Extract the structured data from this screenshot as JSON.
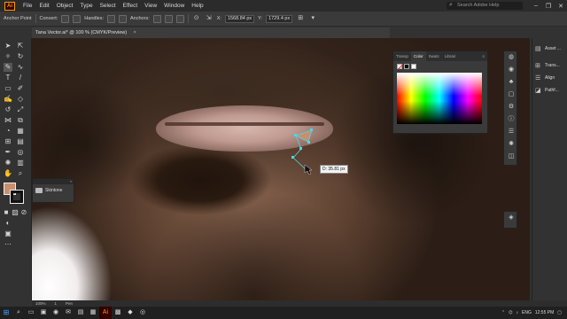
{
  "menubar": {
    "logo": "Ai",
    "items": [
      "File",
      "Edit",
      "Object",
      "Type",
      "Select",
      "Effect",
      "View",
      "Window",
      "Help"
    ],
    "search_placeholder": "Search Adobe Help",
    "window_controls": [
      "–",
      "❐",
      "✕"
    ]
  },
  "controlbar": {
    "tool_label": "Anchor Point",
    "convert_label": "Convert:",
    "handles_label": "Handles:",
    "anchors_label": "Anchors:",
    "x_value": "1568.84 px",
    "y_value": "1729.4 px"
  },
  "document": {
    "tab_title": "Tana Vector.ai* @ 100 % (CMYK/Preview)",
    "close": "×"
  },
  "layers": {
    "header": "«",
    "item": "Skintone"
  },
  "canvas": {
    "measure_label": "D: 35.81 px"
  },
  "color_panel": {
    "tabs": [
      "Transp",
      "Color",
      "Swatc",
      "Librari"
    ],
    "active_tab": "Color",
    "menu": "≡",
    "fill_color": "#c88f6e"
  },
  "right_panels": {
    "items": [
      {
        "icon": "layers-icon",
        "label": "Asset ..."
      },
      {
        "icon": "transform-icon",
        "label": "Trans..."
      },
      {
        "icon": "align-icon",
        "label": "Align"
      },
      {
        "icon": "pathfinder-icon",
        "label": "Pathf..."
      }
    ]
  },
  "statusbar": {
    "zoom": "100%",
    "page": "1",
    "tool": "Pen"
  },
  "taskbar": {
    "time": "12:55 PM",
    "lang": "ENG"
  }
}
